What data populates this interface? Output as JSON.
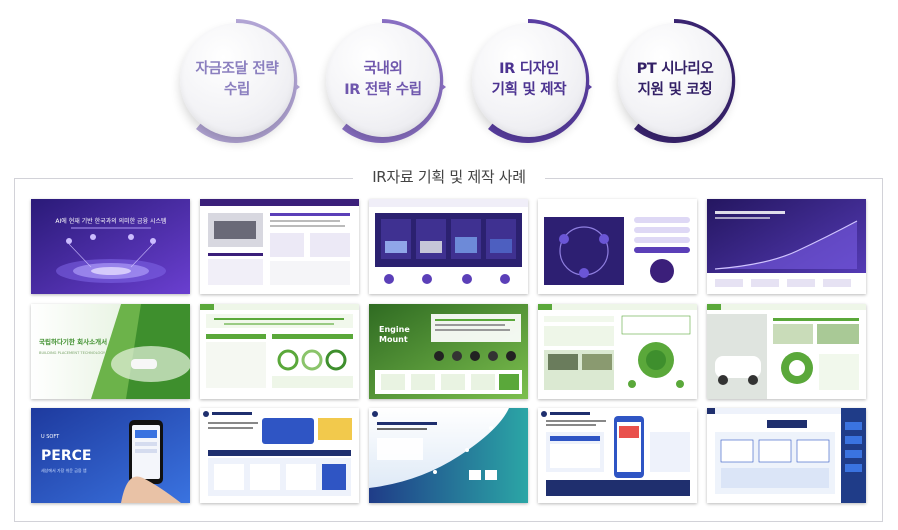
{
  "steps": [
    {
      "label": "자금조달 전략\n수립",
      "ring_color": "#b3a6d6",
      "text_color": "#8b7fbf"
    },
    {
      "label": "국내외\nIR 전략 수립",
      "ring_color": "#8a70c4",
      "text_color": "#6f57ad"
    },
    {
      "label": "IR 디자인\n기획 및 제작",
      "ring_color": "#5b3fa4",
      "text_color": "#4c3391"
    },
    {
      "label": "PT 시나리오\n지원 및 코칭",
      "ring_color": "#3b2572",
      "text_color": "#332066"
    }
  ],
  "gallery": {
    "title": "IR자료 기획 및 제작 사례"
  },
  "thumbs": {
    "t1_title": "AI에 현재 기반 한국과의 의미한 금융 시스템",
    "t11_line1": "국립하다기한 회사소개서",
    "t11_line2": "BUILDING PLACEMENT TECHNOLOGY",
    "t13_brand": "Engine",
    "t13_brand2": "Mount",
    "t16_brand": "U SOFT",
    "t16_title": "PERCE",
    "t16_sub": "세상에서 가장 쉬운 금융 앱"
  },
  "colors": {
    "purple_dark": "#3b1f7a",
    "purple": "#5b3fb8",
    "green": "#5aa83a",
    "blue": "#2f55c4",
    "navy": "#1f2f6e"
  }
}
